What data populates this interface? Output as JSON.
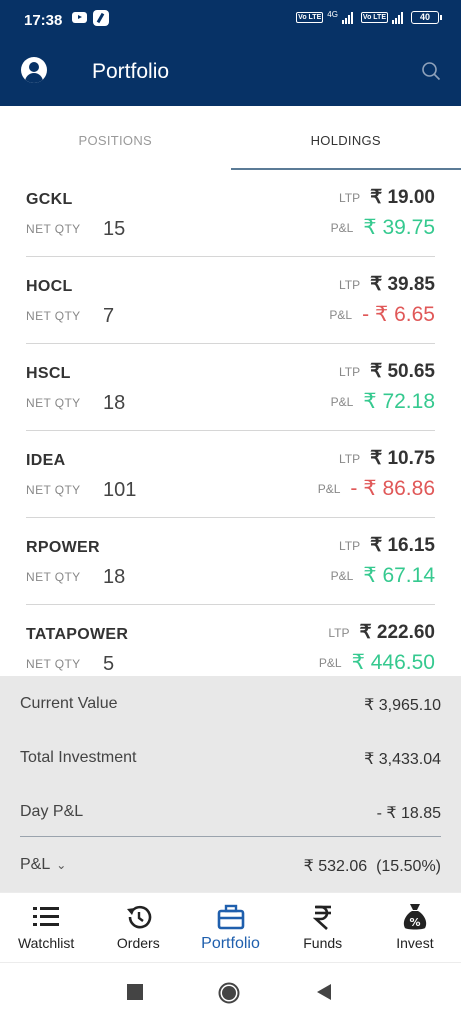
{
  "status_bar": {
    "time": "17:38",
    "network_label": "4G",
    "volte_label": "Vo LTE",
    "battery": "40"
  },
  "header": {
    "title": "Portfolio"
  },
  "tabs": [
    {
      "label": "POSITIONS",
      "active": false
    },
    {
      "label": "HOLDINGS",
      "active": true
    }
  ],
  "labels": {
    "net_qty": "NET QTY",
    "ltp": "LTP",
    "pnl": "P&L"
  },
  "holdings": [
    {
      "symbol": "GCKL",
      "qty": "15",
      "ltp": "₹ 19.00",
      "pnl": "₹ 39.75",
      "pnl_sign": "positive"
    },
    {
      "symbol": "HOCL",
      "qty": "7",
      "ltp": "₹ 39.85",
      "pnl": "- ₹ 6.65",
      "pnl_sign": "negative"
    },
    {
      "symbol": "HSCL",
      "qty": "18",
      "ltp": "₹ 50.65",
      "pnl": "₹ 72.18",
      "pnl_sign": "positive"
    },
    {
      "symbol": "IDEA",
      "qty": "101",
      "ltp": "₹ 10.75",
      "pnl": "- ₹ 86.86",
      "pnl_sign": "negative"
    },
    {
      "symbol": "RPOWER",
      "qty": "18",
      "ltp": "₹ 16.15",
      "pnl": "₹ 67.14",
      "pnl_sign": "positive"
    },
    {
      "symbol": "TATAPOWER",
      "qty": "5",
      "ltp": "₹ 222.60",
      "pnl": "₹ 446.50",
      "pnl_sign": "positive"
    }
  ],
  "summary": {
    "current_value_label": "Current Value",
    "current_value": "₹ 3,965.10",
    "total_investment_label": "Total Investment",
    "total_investment": "₹ 3,433.04",
    "day_pnl_label": "Day P&L",
    "day_pnl": "- ₹ 18.85",
    "pnl_label": "P&L",
    "pnl": "₹ 532.06  (15.50%)"
  },
  "bottom_nav": [
    {
      "label": "Watchlist",
      "icon": "list-icon",
      "active": false
    },
    {
      "label": "Orders",
      "icon": "history-icon",
      "active": false
    },
    {
      "label": "Portfolio",
      "icon": "briefcase-icon",
      "active": true
    },
    {
      "label": "Funds",
      "icon": "rupee-icon",
      "active": false
    },
    {
      "label": "Invest",
      "icon": "money-bag-icon",
      "active": false
    }
  ],
  "colors": {
    "header_bg": "#073266",
    "positive": "#35c98f",
    "negative": "#e05858",
    "active_nav": "#1f5fad",
    "summary_bg": "#e8e8e8"
  }
}
